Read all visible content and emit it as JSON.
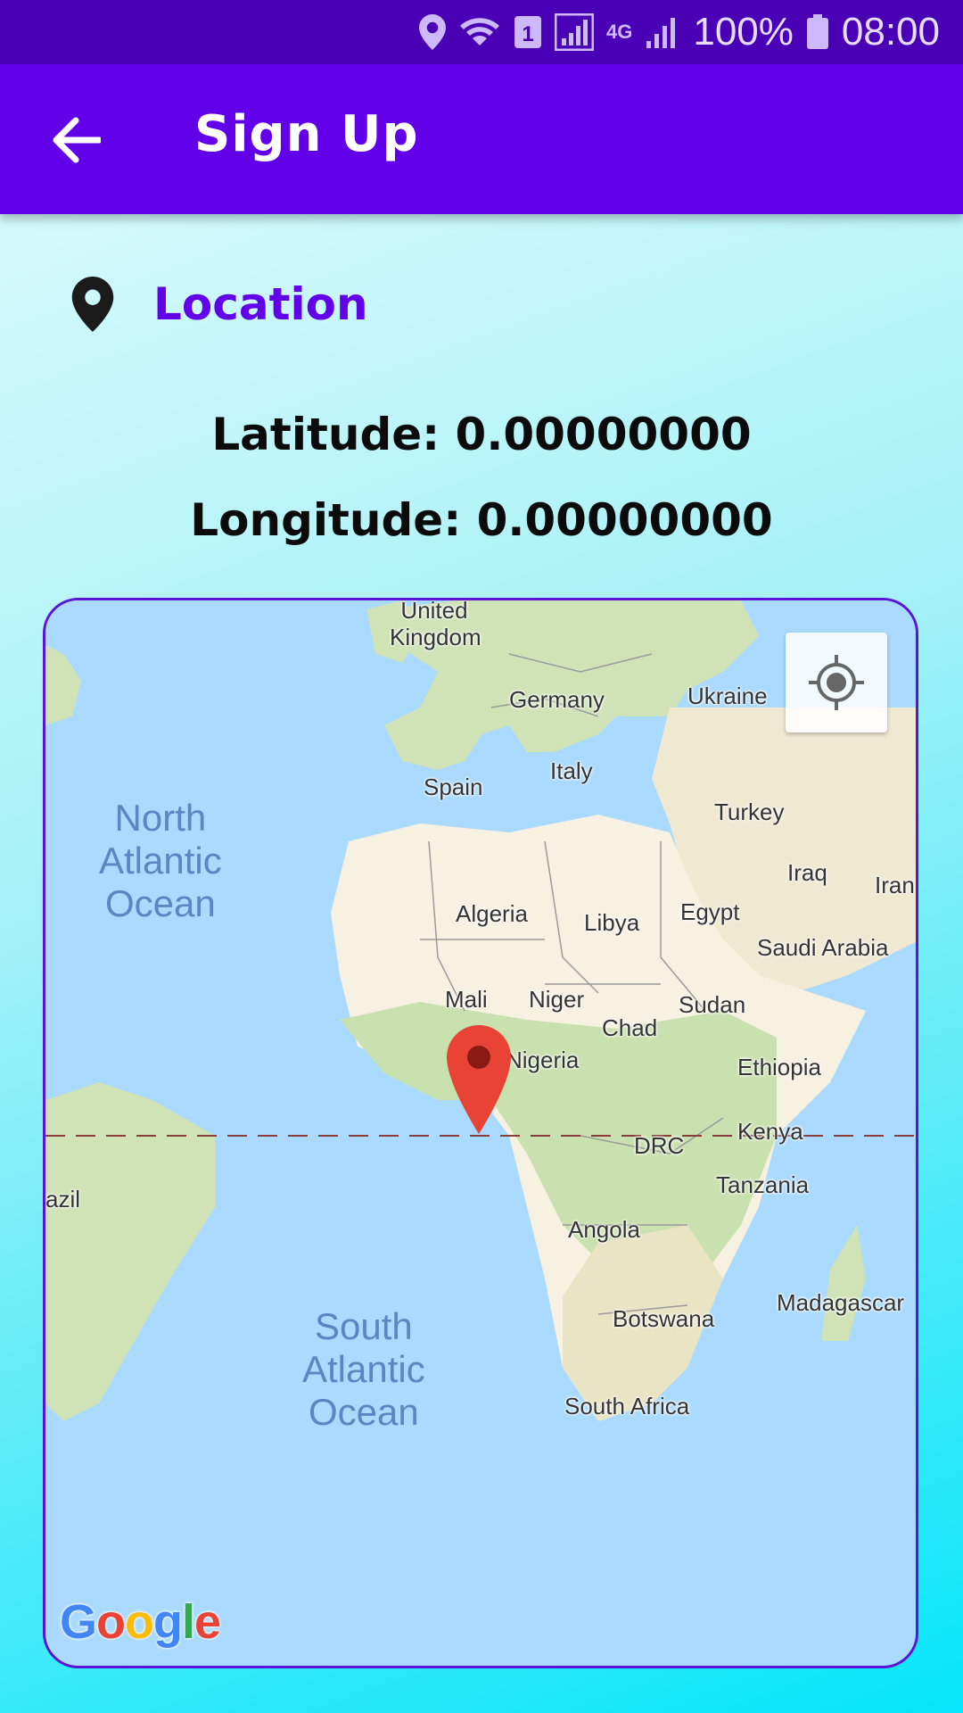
{
  "status_bar": {
    "battery": "100%",
    "time": "08:00",
    "sim_badge": "1",
    "network": "4G"
  },
  "app_bar": {
    "title": "Sign Up",
    "back_icon": "arrow-back-icon"
  },
  "location": {
    "label": "Location",
    "icon": "map-pin-icon",
    "accent": "#6200ea"
  },
  "coordinates": {
    "latitude": "Latitude: 0.00000000",
    "longitude": "Longitude: 0.00000000"
  },
  "map": {
    "country_labels": [
      "United Kingdom",
      "Germany",
      "Ukraine",
      "Italy",
      "Spain",
      "Turkey",
      "Iraq",
      "Iran",
      "Algeria",
      "Libya",
      "Egypt",
      "Saudi Arabia",
      "Mali",
      "Niger",
      "Sudan",
      "Chad",
      "Nigeria",
      "Ethiopia",
      "Kenya",
      "DRC",
      "Tanzania",
      "Angola",
      "Madagascar",
      "Botswana",
      "South Africa",
      "Brazil"
    ],
    "ocean_labels": [
      "North\nAtlantic\nOcean",
      "South\nAtlantic\nOcean"
    ],
    "my_location_icon": "crosshair-target-icon",
    "marker_icon": "red-map-pin-icon",
    "attribution": "Google"
  }
}
